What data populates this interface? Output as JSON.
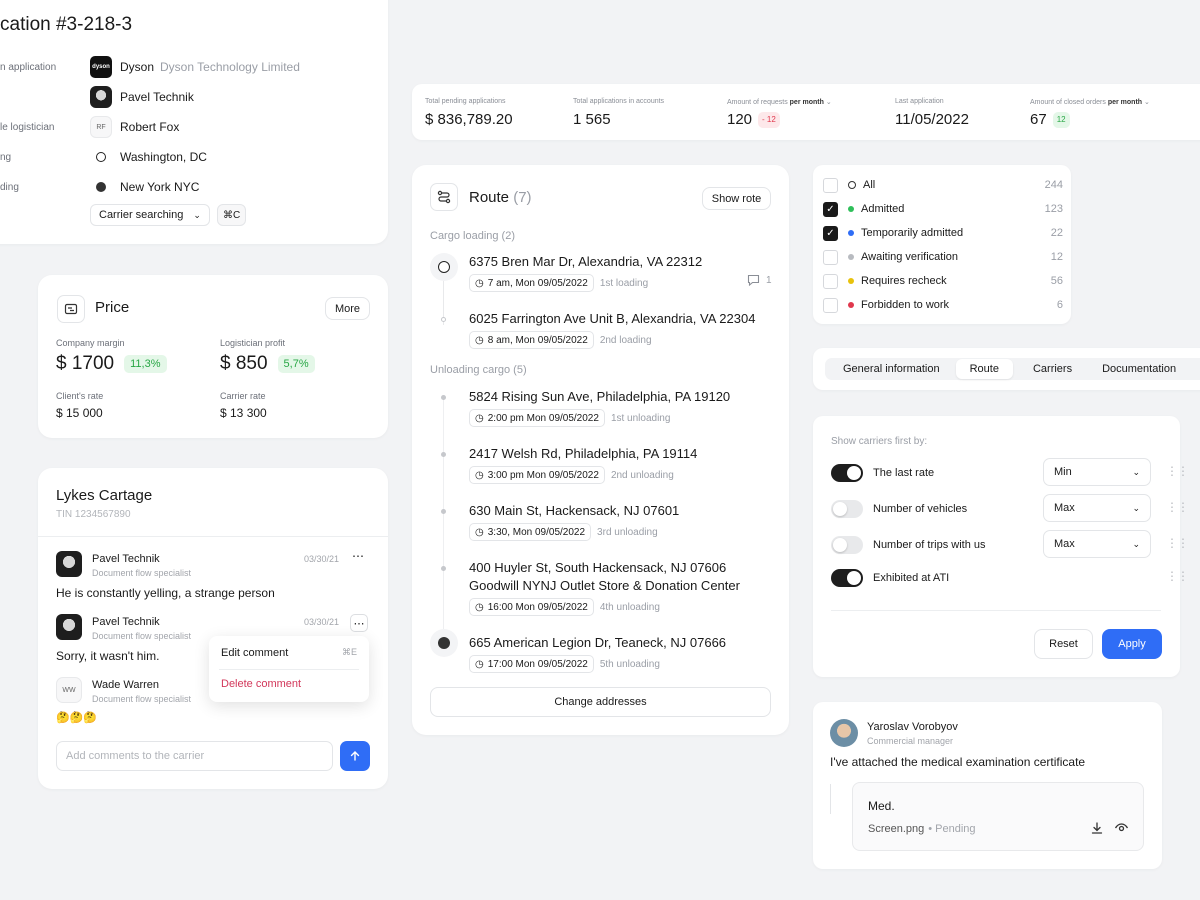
{
  "application": {
    "title": "cation #3-218-3",
    "rows": [
      {
        "label": "n application",
        "value": "Dyson",
        "sub": "Dyson Technology Limited",
        "icon": "dyson-logo"
      },
      {
        "label": "",
        "value": "Pavel Technik",
        "icon": "avatar"
      },
      {
        "label": "le logistician",
        "value": "Robert Fox",
        "icon": "initials",
        "initials": "RF"
      },
      {
        "label": "ng",
        "value": "Washington, DC",
        "icon": "circle-outline-icon"
      },
      {
        "label": "ding",
        "value": "New York NYC",
        "icon": "circle-filled-icon"
      }
    ],
    "status_select": "Carrier searching",
    "shortcut": "⌘C"
  },
  "stats": [
    {
      "label": "Total pending applications",
      "value": "$ 836,789.20"
    },
    {
      "label": "Total applications in accounts",
      "value": "1 565"
    },
    {
      "label": "Amount of requests",
      "label_bold": "per month",
      "value": "120",
      "badge": "- 12",
      "badge_color": "red"
    },
    {
      "label": "Last application",
      "value": "11/05/2022"
    },
    {
      "label": "Amount of closed orders",
      "label_bold": "per month",
      "value": "67",
      "badge": "12",
      "badge_color": "green"
    }
  ],
  "price": {
    "title": "Price",
    "more": "More",
    "company_margin_label": "Company margin",
    "company_margin": "$ 1700",
    "company_margin_pct": "11,3%",
    "logistician_profit_label": "Logistician profit",
    "logistician_profit": "$ 850",
    "logistician_profit_pct": "5,7%",
    "clients_rate_label": "Client's rate",
    "clients_rate": "$ 15 000",
    "carrier_rate_label": "Carrier rate",
    "carrier_rate": "$ 13 300"
  },
  "lykes": {
    "title": "Lykes Cartage",
    "tin": "TIN 1234567890",
    "comments": [
      {
        "name": "Pavel Technik",
        "role": "Document flow specialist",
        "date": "03/30/21",
        "text": "He is constantly yelling, a strange person"
      },
      {
        "name": "Pavel Technik",
        "role": "Document flow specialist",
        "date": "03/30/21",
        "text": "Sorry, it wasn't him."
      },
      {
        "name": "Wade Warren",
        "initials": "WW",
        "role": "Document flow specialist",
        "text": "🤔🤔🤔"
      }
    ],
    "menu": {
      "edit": "Edit comment",
      "edit_shortcut": "⌘E",
      "delete": "Delete comment"
    },
    "input_placeholder": "Add comments to the carrier"
  },
  "route": {
    "title": "Route",
    "count": "(7)",
    "show_button": "Show rote",
    "loading_header": "Cargo loading (2)",
    "unloading_header": "Unloading cargo (5)",
    "loading": [
      {
        "address": "6375 Bren Mar Dr, Alexandria, VA 22312",
        "time": "7 am,  Mon 09/05/2022",
        "tag": "1st loading",
        "comments": "1"
      },
      {
        "address": "6025 Farrington Ave Unit B, Alexandria, VA 22304",
        "time": "8 am,  Mon 09/05/2022",
        "tag": "2nd loading"
      }
    ],
    "unloading": [
      {
        "address": "5824 Rising Sun Ave, Philadelphia, PA 19120",
        "time": "2:00 pm  Mon 09/05/2022",
        "tag": "1st unloading"
      },
      {
        "address": "2417 Welsh Rd, Philadelphia, PA 19114",
        "time": "3:00 pm  Mon 09/05/2022",
        "tag": "2nd unloading"
      },
      {
        "address": "630 Main St, Hackensack, NJ 07601",
        "time": "3:30,  Mon 09/05/2022",
        "tag": "3rd unloading"
      },
      {
        "address": "400 Huyler St, South Hackensack, NJ 07606",
        "address2": "Goodwill NYNJ Outlet Store & Donation Center",
        "time": "16:00  Mon 09/05/2022",
        "tag": "4th unloading"
      },
      {
        "address": "665 American Legion Dr, Teaneck, NJ 07666",
        "time": "17:00  Mon 09/05/2022",
        "tag": "5th unloading"
      }
    ],
    "change_button": "Change addresses"
  },
  "filters": [
    {
      "label": "All",
      "count": "244",
      "checked": false,
      "dot": "outline"
    },
    {
      "label": "Admitted",
      "count": "123",
      "checked": true,
      "color": "#2fbf5a"
    },
    {
      "label": "Temporarily admitted",
      "count": "22",
      "checked": true,
      "color": "#2f6df6"
    },
    {
      "label": "Awaiting verification",
      "count": "12",
      "checked": false,
      "color": "#b8bbc0"
    },
    {
      "label": "Requires recheck",
      "count": "56",
      "checked": false,
      "color": "#e8c20c"
    },
    {
      "label": "Forbidden to work",
      "count": "6",
      "checked": false,
      "color": "#e0384d"
    }
  ],
  "tabs": [
    "General information",
    "Route",
    "Carriers",
    "Documentation"
  ],
  "active_tab": "Route",
  "carriers_sort": {
    "header": "Show carriers first by:",
    "rows": [
      {
        "label": "The last rate",
        "on": true,
        "select": "Min"
      },
      {
        "label": "Number of vehicles",
        "on": false,
        "select": "Max"
      },
      {
        "label": "Number of trips with us",
        "on": false,
        "select": "Max"
      },
      {
        "label": "Exhibited at ATI",
        "on": true
      }
    ],
    "reset": "Reset",
    "apply": "Apply"
  },
  "attachment": {
    "name": "Yaroslav Vorobyov",
    "role": "Commercial manager",
    "message": "I've attached the medical examination certificate",
    "file_title": "Med.",
    "file_name": "Screen.png",
    "file_status": "• Pending"
  },
  "colors": {
    "accent": "#2f6df6",
    "danger": "#d2375a"
  }
}
